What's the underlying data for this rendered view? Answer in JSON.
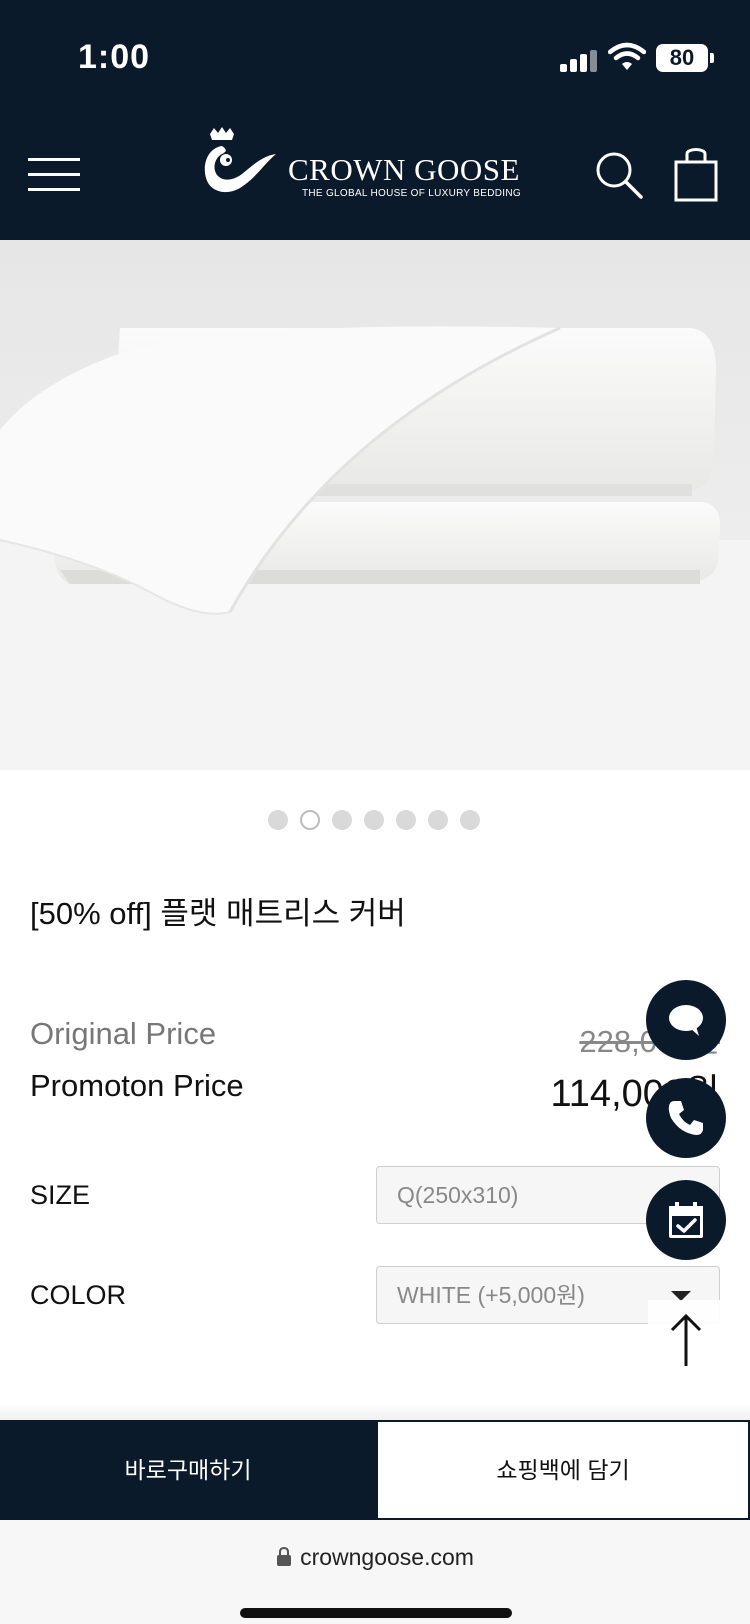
{
  "status_bar": {
    "time": "1:00",
    "battery": "80"
  },
  "header": {
    "brand_name": "CROWN GOOSE",
    "brand_tagline": "THE GLOBAL HOUSE OF LUXURY BEDDING",
    "icons": [
      "menu-icon",
      "crown-goose-logo",
      "search-icon",
      "shopping-bag-icon"
    ],
    "background_color": "#0b1a2b"
  },
  "gallery": {
    "total_images": 7,
    "active_index": 1
  },
  "product": {
    "title": "[50% off] 플랫 매트리스 커버",
    "original_price_label": "Original Price",
    "original_price": "228,000원",
    "promo_price_label": "Promoton Price",
    "promo_price": "114,000원"
  },
  "options": {
    "size_label": "SIZE",
    "size_value": "Q(250x310)",
    "color_label": "COLOR",
    "color_value": "WHITE (+5,000원)"
  },
  "floating_actions": [
    "chat-icon",
    "phone-icon",
    "calendar-check-icon",
    "arrow-up-icon"
  ],
  "cta": {
    "buy_now": "바로구매하기",
    "add_to_bag": "쇼핑백에 담기"
  },
  "browser": {
    "url": "crowngoose.com"
  }
}
